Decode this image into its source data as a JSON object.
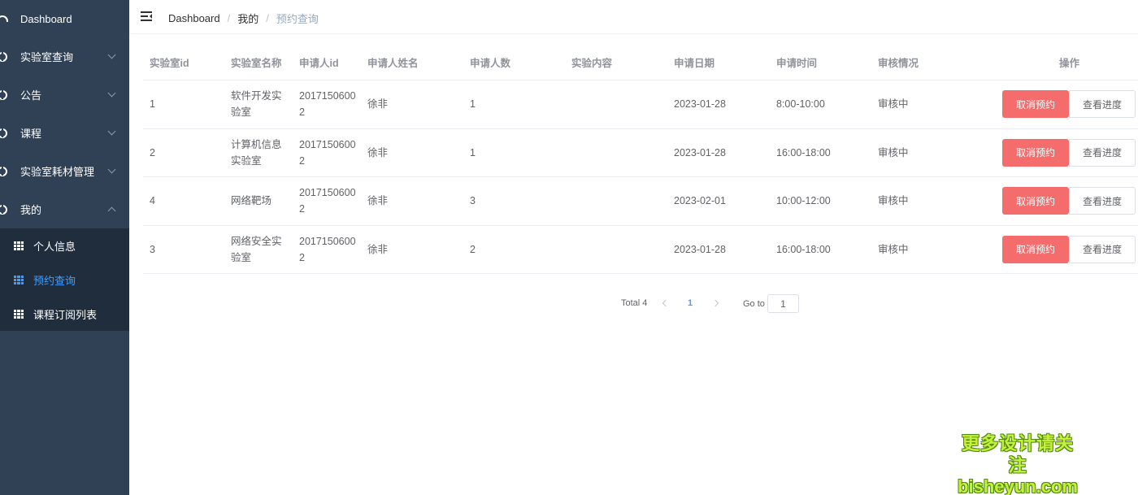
{
  "sidebar": {
    "items": [
      {
        "label": "Dashboard"
      },
      {
        "label": "实验室查询"
      },
      {
        "label": "公告"
      },
      {
        "label": "课程"
      },
      {
        "label": "实验室耗材管理"
      },
      {
        "label": "我的"
      }
    ],
    "submenu": [
      {
        "label": "个人信息"
      },
      {
        "label": "预约查询"
      },
      {
        "label": "课程订阅列表"
      }
    ]
  },
  "breadcrumb": [
    "Dashboard",
    "我的",
    "预约查询"
  ],
  "table": {
    "headers": [
      "实验室id",
      "实验室名称",
      "申请人id",
      "申请人姓名",
      "申请人数",
      "实验内容",
      "申请日期",
      "申请时间",
      "审核情况",
      "操作"
    ],
    "rows": [
      {
        "lab_id": "1",
        "lab_name": "软件开发实验室",
        "applicant_id": "20171506002",
        "applicant_name": "徐非",
        "count": "1",
        "content": "",
        "date": "2023-01-28",
        "time": "8:00-10:00",
        "status": "审核中"
      },
      {
        "lab_id": "2",
        "lab_name": "计算机信息实验室",
        "applicant_id": "20171506002",
        "applicant_name": "徐非",
        "count": "1",
        "content": "",
        "date": "2023-01-28",
        "time": "16:00-18:00",
        "status": "审核中"
      },
      {
        "lab_id": "4",
        "lab_name": "网络靶场",
        "applicant_id": "20171506002",
        "applicant_name": "徐非",
        "count": "3",
        "content": "",
        "date": "2023-02-01",
        "time": "10:00-12:00",
        "status": "审核中"
      },
      {
        "lab_id": "3",
        "lab_name": "网络安全实验室",
        "applicant_id": "20171506002",
        "applicant_name": "徐非",
        "count": "2",
        "content": "",
        "date": "2023-01-28",
        "time": "16:00-18:00",
        "status": "审核中"
      }
    ],
    "actions": {
      "cancel_label": "取消预约",
      "progress_label": "查看进度"
    }
  },
  "pagination": {
    "total": "Total 4",
    "current_page": "1",
    "goto_label": "Go to",
    "goto_value": "1"
  },
  "watermark": {
    "line1": "更多设计请关注",
    "line2": "bisheyun.com"
  },
  "colors": {
    "sidebar_bg": "#304156",
    "submenu_bg": "#1f2d3d",
    "accent": "#409eff",
    "danger": "#f56c6c"
  }
}
